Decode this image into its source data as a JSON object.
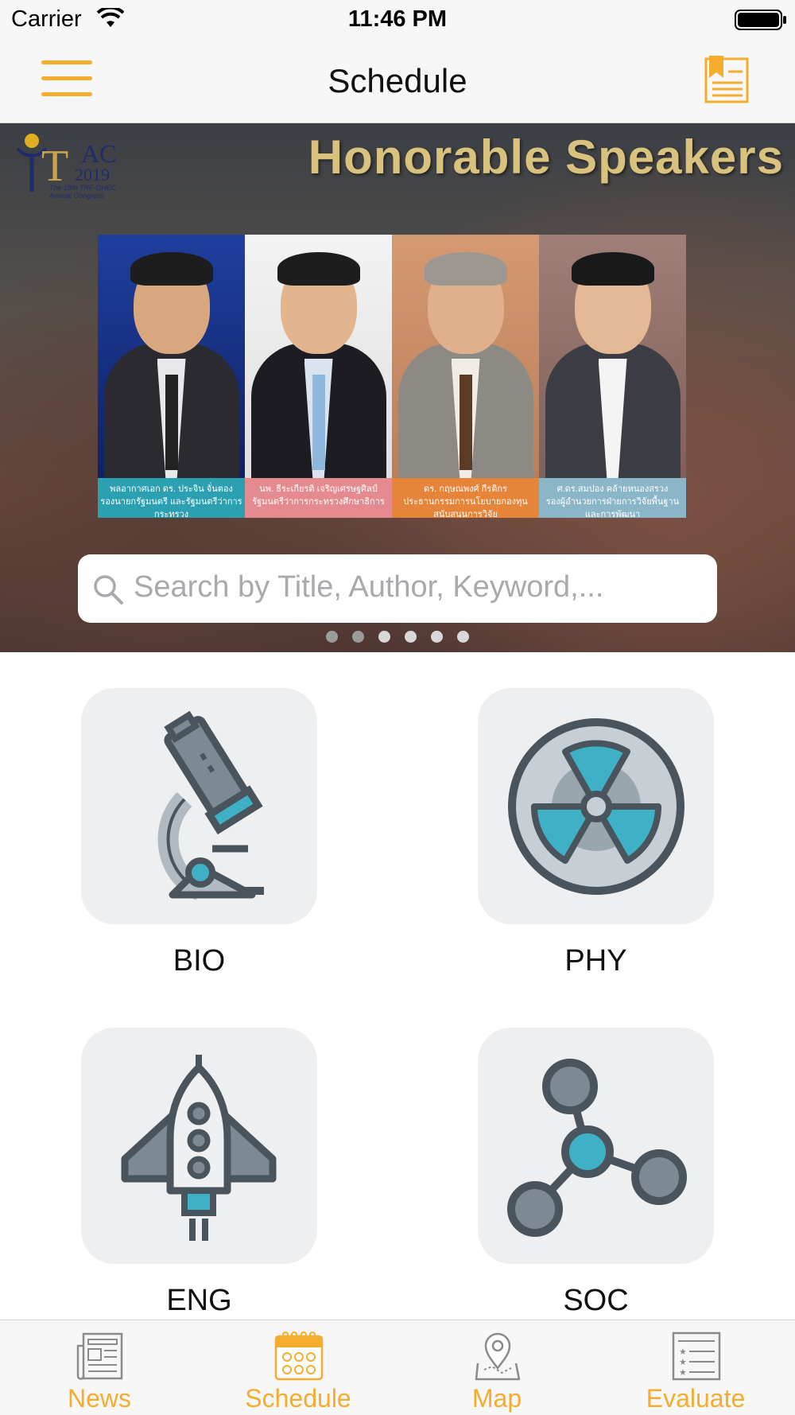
{
  "status_bar": {
    "carrier": "Carrier",
    "time": "11:46 PM"
  },
  "nav": {
    "title": "Schedule",
    "menu_icon": "hamburger-menu-icon",
    "bookmark_icon": "bookmark-document-icon"
  },
  "banner": {
    "logo_text_ac": "AC",
    "logo_text_year": "2019",
    "logo_subtitle": "The 18th TRF-OHEC Annual Congress",
    "headline": "Honorable Speakers",
    "speakers": [
      {
        "name": "พลอากาศเอก ดร. ประจิน จั่นตอง",
        "role": "รองนายกรัฐมนตรี และรัฐมนตรีว่าการกระทรวง"
      },
      {
        "name": "นพ. ธีระเกียรติ เจริญเศรษฐศิลป์",
        "role": "รัฐมนตรีว่าการกระทรวงศึกษาธิการ"
      },
      {
        "name": "ดร. กฤษณพงศ์ กีรติกร",
        "role": "ประธานกรรมการนโยบายกองทุนสนับสนุนการวิจัย"
      },
      {
        "name": "ศ.ดร.สมปอง คล้ายหนองสรวง",
        "role": "รองผู้อำนวยการฝ่ายการวิจัยพื้นฐานและการพัฒนา"
      }
    ],
    "page_count": 6,
    "active_page": 2
  },
  "search": {
    "placeholder": "Search by Title, Author, Keyword,..."
  },
  "categories": [
    {
      "label": "BIO",
      "icon": "microscope-icon"
    },
    {
      "label": "PHY",
      "icon": "radiation-icon"
    },
    {
      "label": "ENG",
      "icon": "rocket-icon"
    },
    {
      "label": "SOC",
      "icon": "molecule-icon"
    }
  ],
  "tabs": [
    {
      "label": "News",
      "icon": "newspaper-icon",
      "active": false
    },
    {
      "label": "Schedule",
      "icon": "calendar-icon",
      "active": true
    },
    {
      "label": "Map",
      "icon": "map-pin-icon",
      "active": false
    },
    {
      "label": "Evaluate",
      "icon": "checklist-icon",
      "active": false
    }
  ],
  "colors": {
    "accent": "#f4ad2e",
    "tile_bg": "#eeeff0",
    "icon_dark": "#4a545c",
    "icon_grey": "#7c8a94",
    "icon_teal": "#3fb1c6"
  }
}
